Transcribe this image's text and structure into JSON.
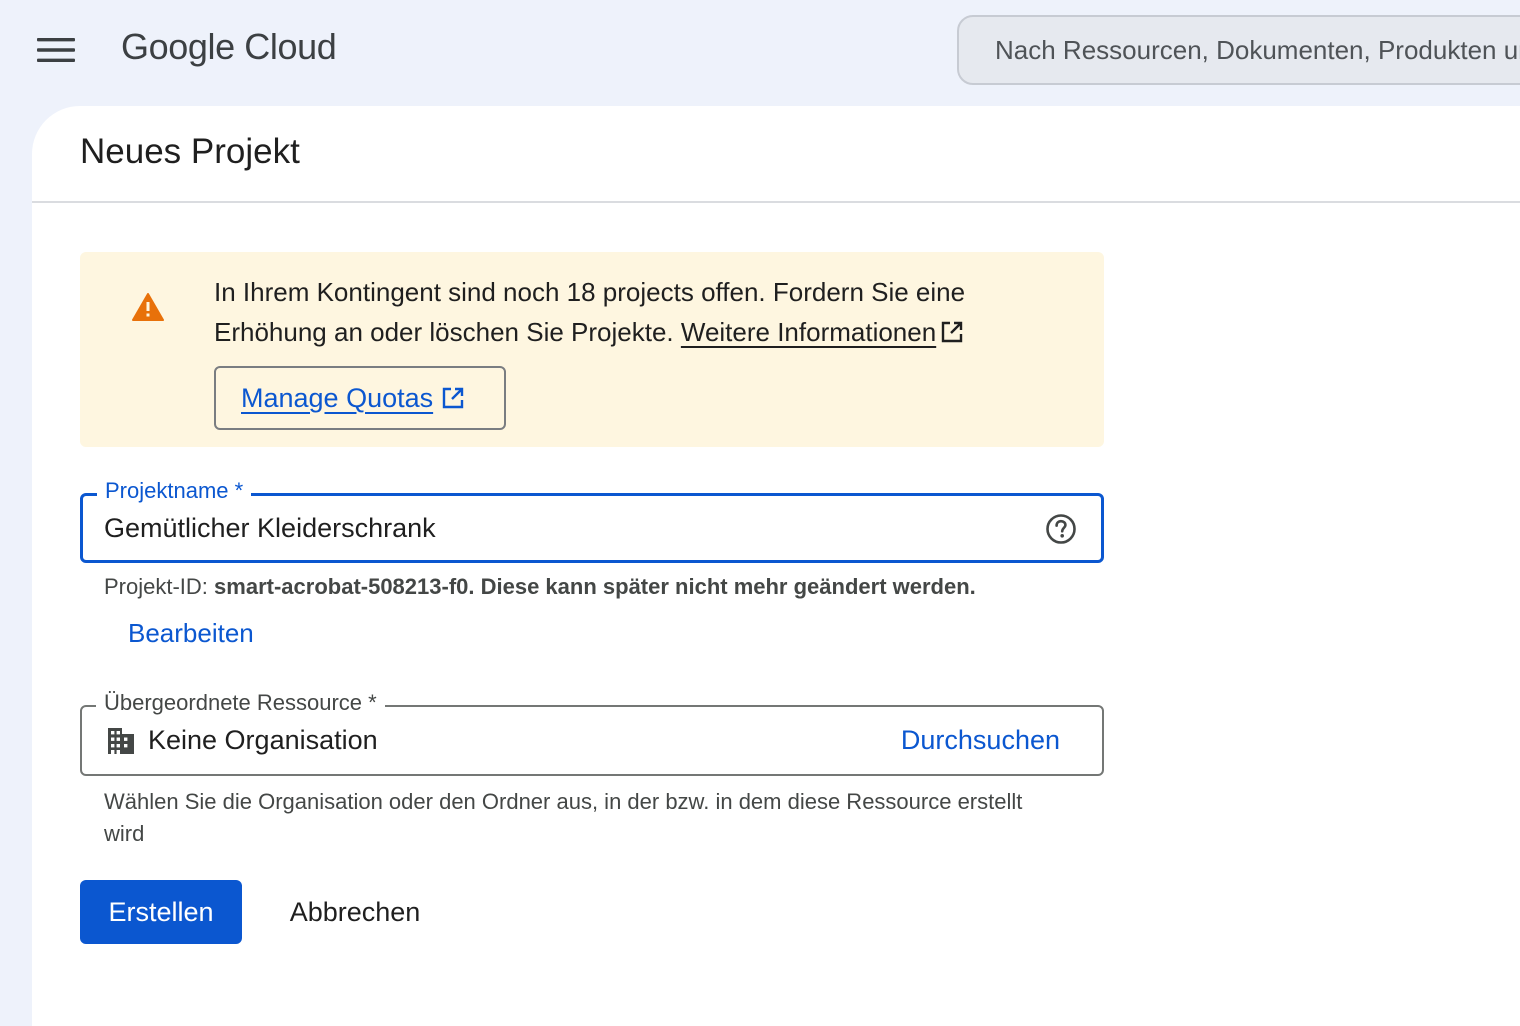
{
  "header": {
    "menu_icon": "hamburger-menu-icon",
    "logo_text": "Google Cloud",
    "search_placeholder": "Nach Ressourcen, Dokumenten, Produkten und mehr suchen"
  },
  "page": {
    "title": "Neues Projekt"
  },
  "warning": {
    "icon": "warning-triangle-icon",
    "text": "In Ihrem Kontingent sind noch 18 projects offen. Fordern Sie eine Erhöhung an oder löschen Sie Projekte.",
    "link_label": "Weitere Informationen",
    "button_label": "Manage Quotas",
    "accent_color": "#e8710a"
  },
  "project_name": {
    "label": "Projektname *",
    "value": "Gemütlicher Kleiderschrank",
    "help_icon": "help-circle-icon"
  },
  "project_id": {
    "prefix": "Projekt-ID:",
    "id_text": "smart-acrobat-508213-f0. Diese kann später nicht mehr geändert werden.",
    "edit_label": "Bearbeiten"
  },
  "parent_resource": {
    "label": "Übergeordnete Ressource *",
    "icon": "organization-building-icon",
    "value": "Keine Organisation",
    "browse_label": "Durchsuchen",
    "hint": "Wählen Sie die Organisation oder den Ordner aus, in der bzw. in dem diese Ressource erstellt wird"
  },
  "actions": {
    "create_label": "Erstellen",
    "cancel_label": "Abbrechen"
  },
  "colors": {
    "primary": "#0b57d0",
    "warning_bg": "#fef6e0",
    "page_bg": "#eef2fb"
  }
}
